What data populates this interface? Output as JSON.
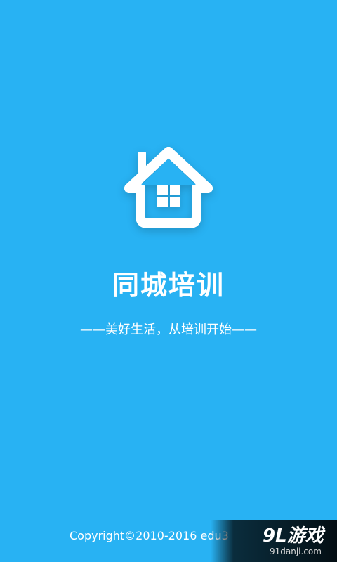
{
  "app": {
    "title": "同城培训",
    "slogan": "——美好生活，从培训开始——",
    "copyright": "Copyright©2010-2016 edu3"
  },
  "watermark": {
    "brand": "9L游戏",
    "domain": "91danji.com"
  },
  "icons": {
    "logo": "house-icon"
  },
  "colors": {
    "background": "#28b2f3",
    "foreground": "#ffffff"
  }
}
